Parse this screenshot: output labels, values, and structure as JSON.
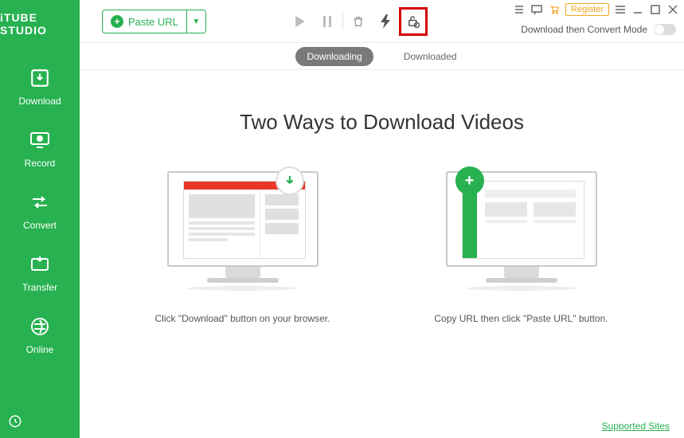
{
  "app": {
    "name": "iTUBE STUDIO"
  },
  "sidebar": {
    "items": [
      {
        "label": "Download"
      },
      {
        "label": "Record"
      },
      {
        "label": "Convert"
      },
      {
        "label": "Transfer"
      },
      {
        "label": "Online"
      }
    ]
  },
  "toolbar": {
    "paste_label": "Paste URL",
    "register_label": "Register",
    "mode_label": "Download then Convert Mode"
  },
  "tabs": {
    "downloading": "Downloading",
    "downloaded": "Downloaded"
  },
  "content": {
    "headline": "Two Ways to Download Videos",
    "way1_caption": "Click \"Download\" button on your browser.",
    "way2_caption": "Copy URL then click \"Paste URL\" button."
  },
  "footer": {
    "supported_sites": "Supported Sites"
  }
}
